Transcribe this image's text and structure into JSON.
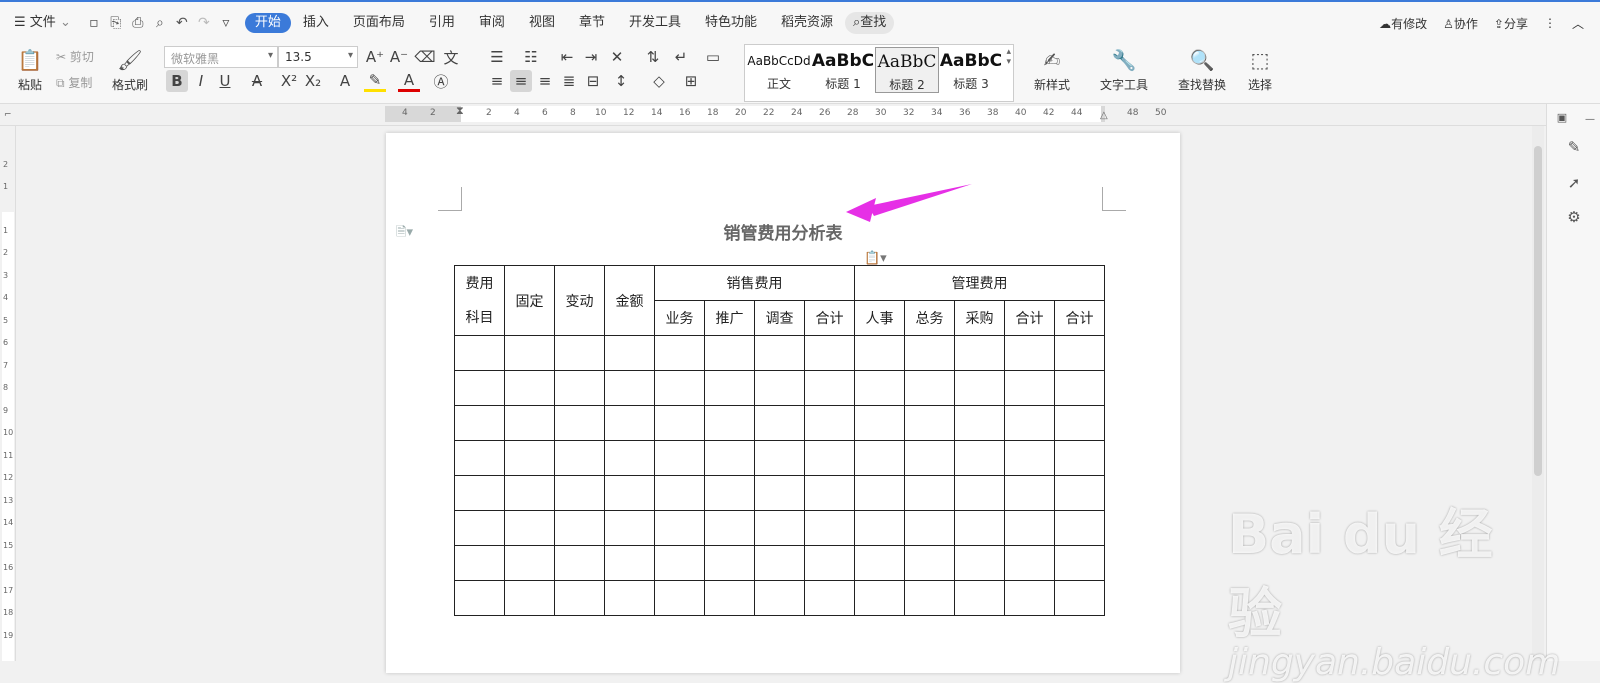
{
  "topbar": {
    "file_menu": "文件",
    "tabs": [
      "开始",
      "插入",
      "页面布局",
      "引用",
      "审阅",
      "视图",
      "章节",
      "开发工具",
      "特色功能",
      "稻壳资源"
    ],
    "active_tab": "开始",
    "search_label": "查找",
    "has_changes": "有修改",
    "collaborate": "协作",
    "share": "分享"
  },
  "ribbon": {
    "paste": "粘贴",
    "cut": "剪切",
    "copy": "复制",
    "format_painter": "格式刷",
    "font_name": "微软雅黑",
    "font_size": "13.5",
    "styles": [
      {
        "preview": "AaBbCcDd",
        "name": "正文"
      },
      {
        "preview": "AaBbC",
        "name": "标题 1"
      },
      {
        "preview": "AaBbC",
        "name": "标题 2"
      },
      {
        "preview": "AaBbC",
        "name": "标题 3"
      }
    ],
    "new_style": "新样式",
    "text_tools": "文字工具",
    "find_replace": "查找替换",
    "select": "选择"
  },
  "ruler": {
    "h_labels": [
      "4",
      "2",
      "2",
      "4",
      "6",
      "8",
      "10",
      "12",
      "14",
      "16",
      "18",
      "20",
      "22",
      "24",
      "26",
      "28",
      "30",
      "32",
      "34",
      "36",
      "38",
      "40",
      "42",
      "44",
      "48",
      "50"
    ],
    "v_labels": [
      "2",
      "1",
      "1",
      "2",
      "3",
      "4",
      "5",
      "6",
      "7",
      "8",
      "9",
      "10",
      "11",
      "12",
      "13",
      "14",
      "15",
      "16",
      "17",
      "18",
      "19"
    ]
  },
  "document": {
    "title": "销管费用分析表",
    "header_row1": [
      "费用",
      "固定",
      "变动",
      "金额",
      "销售费用",
      "管理费用"
    ],
    "header_row1b": "科目",
    "header_row2": [
      "业务",
      "推广",
      "调查",
      "合计",
      "人事",
      "总务",
      "采购",
      "合计",
      "合计"
    ],
    "empty_rows": 8
  },
  "watermark": {
    "main": "Bai du 经验",
    "sub": "jingyan.baidu.com"
  },
  "colors": {
    "accent": "#3b7ad9",
    "arrow": "#e62fe6"
  }
}
